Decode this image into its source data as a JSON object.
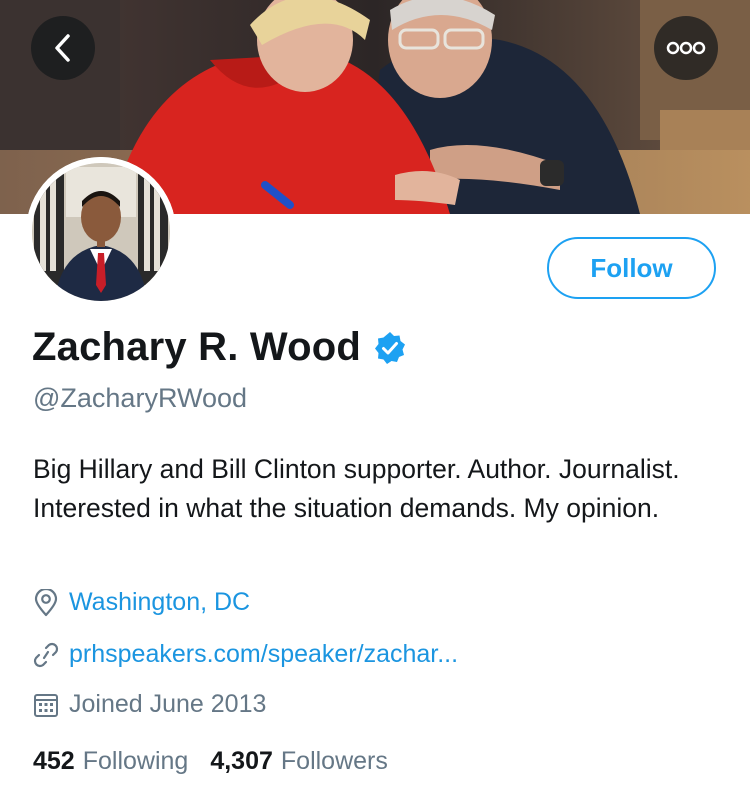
{
  "profile": {
    "name": "Zachary R. Wood",
    "handle": "@ZacharyRWood",
    "bio": "Big Hillary and Bill Clinton supporter. Author. Journalist. Interested in what the situation demands. My opinion.",
    "location": "Washington, DC",
    "website": "prhspeakers.com/speaker/zachar...",
    "joined": "Joined June 2013",
    "verified": true
  },
  "actions": {
    "follow_label": "Follow"
  },
  "stats": {
    "following_count": "452",
    "following_label": "Following",
    "followers_count": "4,307",
    "followers_label": "Followers"
  },
  "icons": {
    "back": "chevron-left-icon",
    "more": "more-dots-icon",
    "verified": "verified-badge-icon",
    "location": "location-pin-icon",
    "website": "link-icon",
    "joined": "calendar-icon"
  },
  "colors": {
    "accent": "#1da1f2",
    "link": "#1b95e0",
    "secondary_text": "#657786",
    "primary_text": "#14171a"
  }
}
